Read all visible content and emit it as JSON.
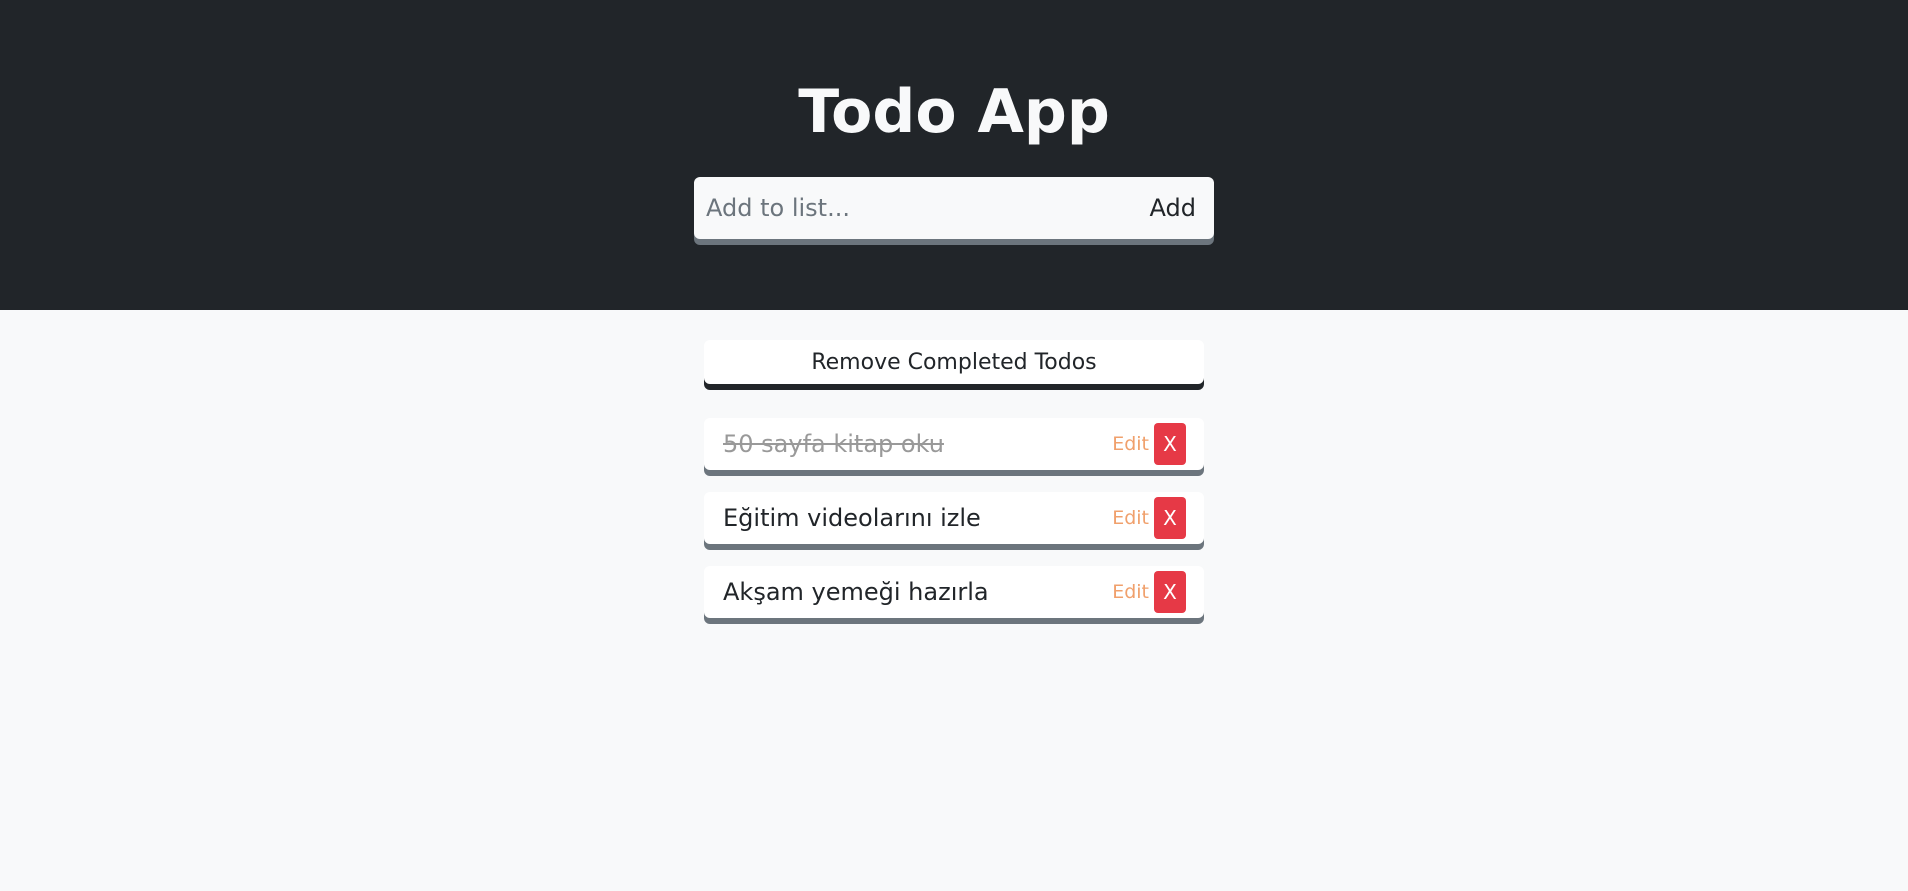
{
  "header": {
    "title": "Todo App",
    "add_placeholder": "Add to list...",
    "add_value": "",
    "add_label": "Add"
  },
  "actions": {
    "remove_completed_label": "Remove Completed Todos"
  },
  "todos": [
    {
      "text": "50 sayfa kitap oku",
      "completed": true,
      "edit_label": "Edit",
      "delete_label": "X"
    },
    {
      "text": "Eğitim videolarını izle",
      "completed": false,
      "edit_label": "Edit",
      "delete_label": "X"
    },
    {
      "text": "Akşam yemeği hazırla",
      "completed": false,
      "edit_label": "Edit",
      "delete_label": "X"
    }
  ],
  "colors": {
    "header_bg": "#212529",
    "page_bg": "#f8f9fa",
    "edit": "#f0a06c",
    "delete": "#e63946",
    "completed_text": "#999999"
  }
}
